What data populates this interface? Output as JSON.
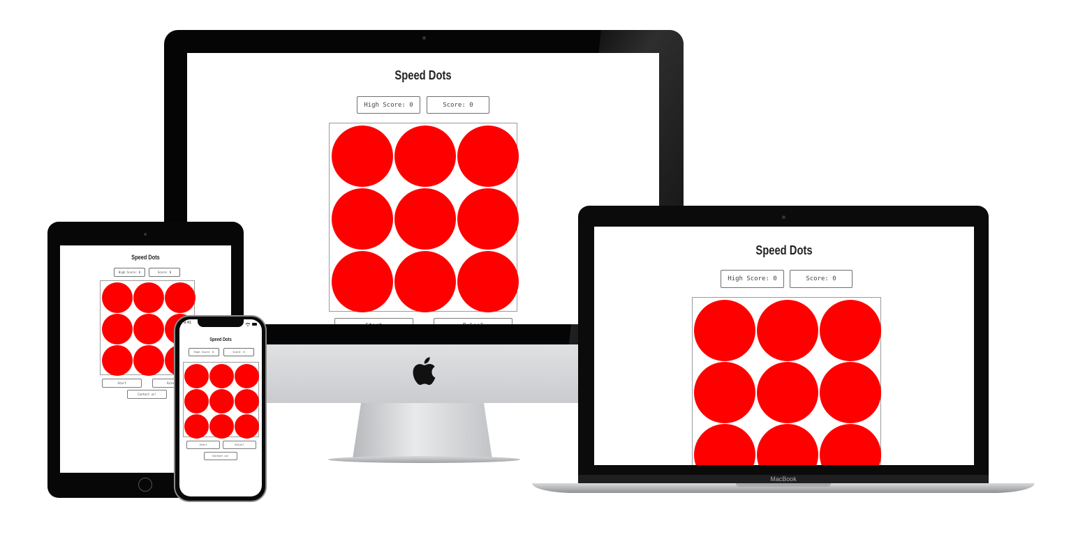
{
  "app": {
    "title": "Speed Dots",
    "high_score_label": "High Score: 0",
    "score_label": "Score: 0",
    "start_label": "Start",
    "rules_label": "Rules?",
    "contact_label": "Contact us!",
    "dot_color": "#ff0000",
    "dots": [
      1,
      2,
      3,
      4,
      5,
      6,
      7,
      8,
      9
    ]
  },
  "devices": {
    "macbook_label": "MacBook",
    "iphone_time": "9:41"
  },
  "colors": {
    "dot": "#ff0000",
    "bezel": "#050505",
    "background": "#ffffff"
  }
}
